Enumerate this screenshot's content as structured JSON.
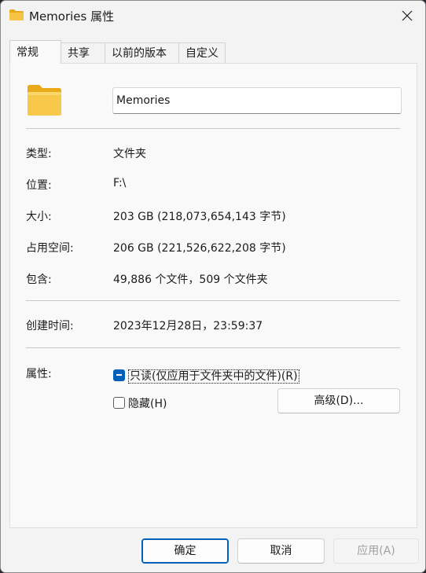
{
  "window": {
    "title": "Memories 属性",
    "close_icon": "close-icon"
  },
  "tabs": [
    {
      "label": "常规",
      "active": true
    },
    {
      "label": "共享",
      "active": false
    },
    {
      "label": "以前的版本",
      "active": false
    },
    {
      "label": "自定义",
      "active": false
    }
  ],
  "general": {
    "folder_name": "Memories",
    "type_label": "类型:",
    "type_value": "文件夹",
    "location_label": "位置:",
    "location_value": "F:\\",
    "size_label": "大小:",
    "size_value": "203 GB (218,073,654,143 字节)",
    "disk_size_label": "占用空间:",
    "disk_size_value": "206 GB (221,526,622,208 字节)",
    "contains_label": "包含:",
    "contains_value": "49,886 个文件，509 个文件夹",
    "created_label": "创建时间:",
    "created_value": "2023年12月28日，23:59:37",
    "attributes_label": "属性:",
    "readonly_label": "只读(仅应用于文件夹中的文件)(R)",
    "readonly_state": "indeterminate",
    "hidden_label": "隐藏(H)",
    "hidden_state": "unchecked",
    "advanced_label": "高级(D)..."
  },
  "footer": {
    "ok_label": "确定",
    "cancel_label": "取消",
    "apply_label": "应用(A)"
  },
  "colors": {
    "accent": "#005fb8",
    "folder": "#f6c445"
  }
}
